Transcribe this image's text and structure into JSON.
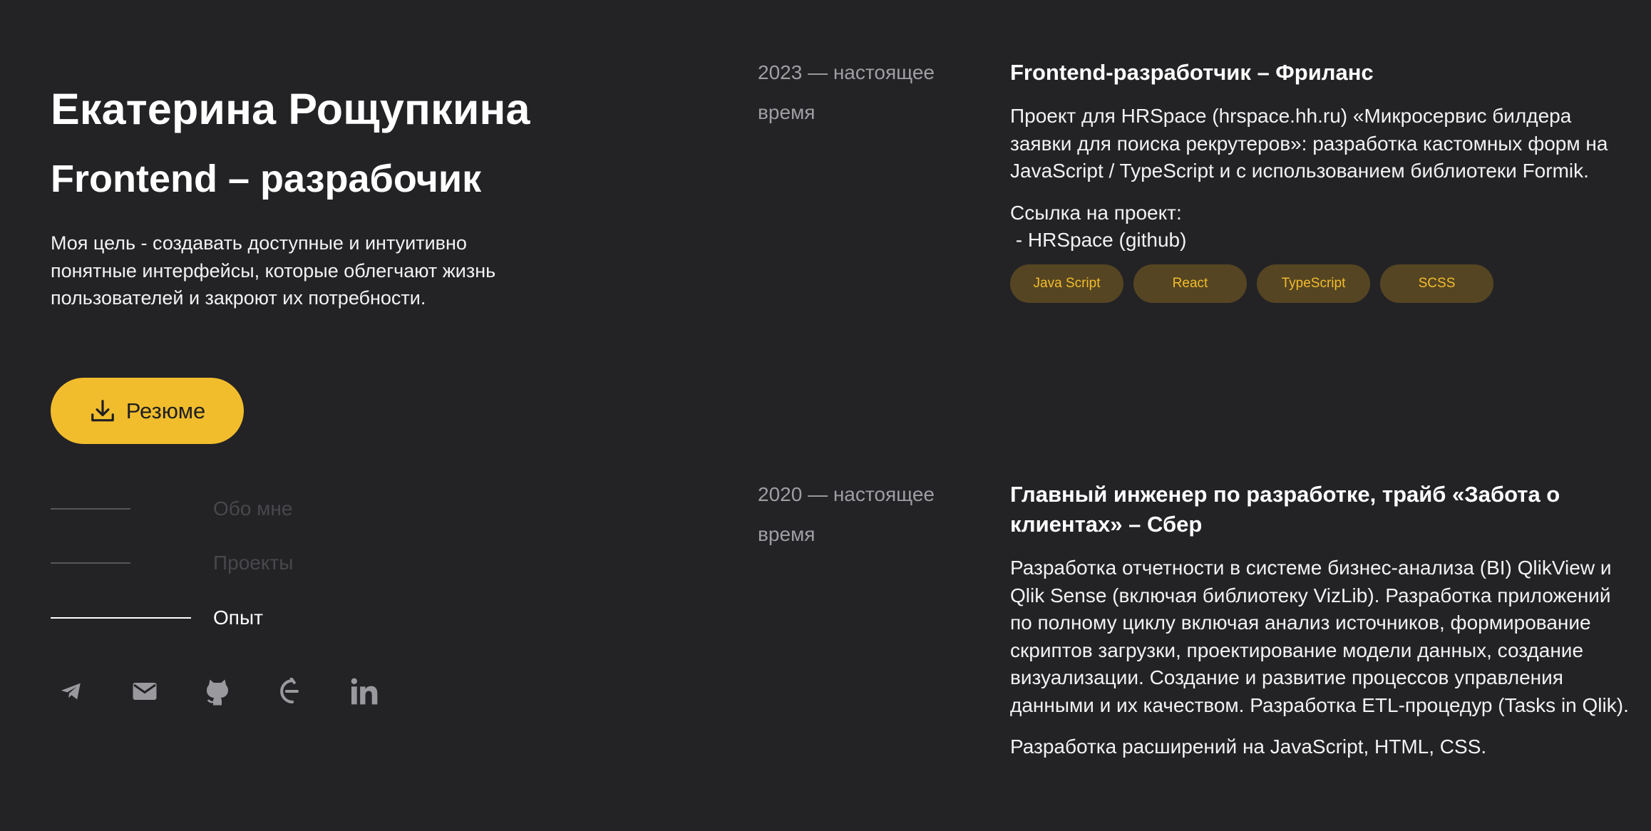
{
  "profile": {
    "name": "Екатерина Рощупкина",
    "role": "Frontend – разрабочик",
    "about": "Моя цель - создавать доступные и интуитивно понятные интерфейсы, которые облегчают жизнь пользователей и закроют их потребности.",
    "resume_label": "Резюме",
    "resume_icon": "download-icon"
  },
  "nav": {
    "items": [
      {
        "label": "Обо мне",
        "active": false
      },
      {
        "label": "Проекты",
        "active": false
      },
      {
        "label": "Опыт",
        "active": true
      }
    ]
  },
  "socials": [
    {
      "icon": "telegram-icon"
    },
    {
      "icon": "mail-icon"
    },
    {
      "icon": "github-icon"
    },
    {
      "icon": "habr-icon"
    },
    {
      "icon": "linkedin-icon"
    }
  ],
  "experience": [
    {
      "period": "2023 — настоящее время",
      "title": "Frontend-разработчик – Фриланс",
      "description": [
        "Проект для HRSpace (hrspace.hh.ru) «Микросервис билдера заявки для поиска рекрутеров»: разработка кастомных форм на JavaScript / TypeScript и с использованием библиотеки Formik."
      ],
      "links_label": "Ссылка на проект:",
      "links": [
        "HRSpace (github)"
      ],
      "tags": [
        "Java Script",
        "React",
        "TypeScript",
        "SCSS"
      ]
    },
    {
      "period": "2020 — настоящее время",
      "title": "Главный инженер по разработке, трайб «Забота о клиентах» – Сбер",
      "description": [
        "Разработка отчетности в системе бизнес-анализа (BI) QlikView и Qlik Sense (включая библиотеку VizLib). Разработка приложений по полному циклу включая анализ источников, формирование скриптов загрузки, проектирование модели данных, создание визуализации. Создание и развитие процессов управления данными и их качеством. Разработка ETL-процедур (Tasks in Qlik).",
        "Разработка расширений на JavaScript, HTML, CSS."
      ]
    }
  ],
  "colors": {
    "background": "#232326",
    "accent": "#f2bd2d",
    "tag_background": "#564522",
    "muted_text": "#9e9ea3",
    "inactive_nav": "#48484c"
  }
}
